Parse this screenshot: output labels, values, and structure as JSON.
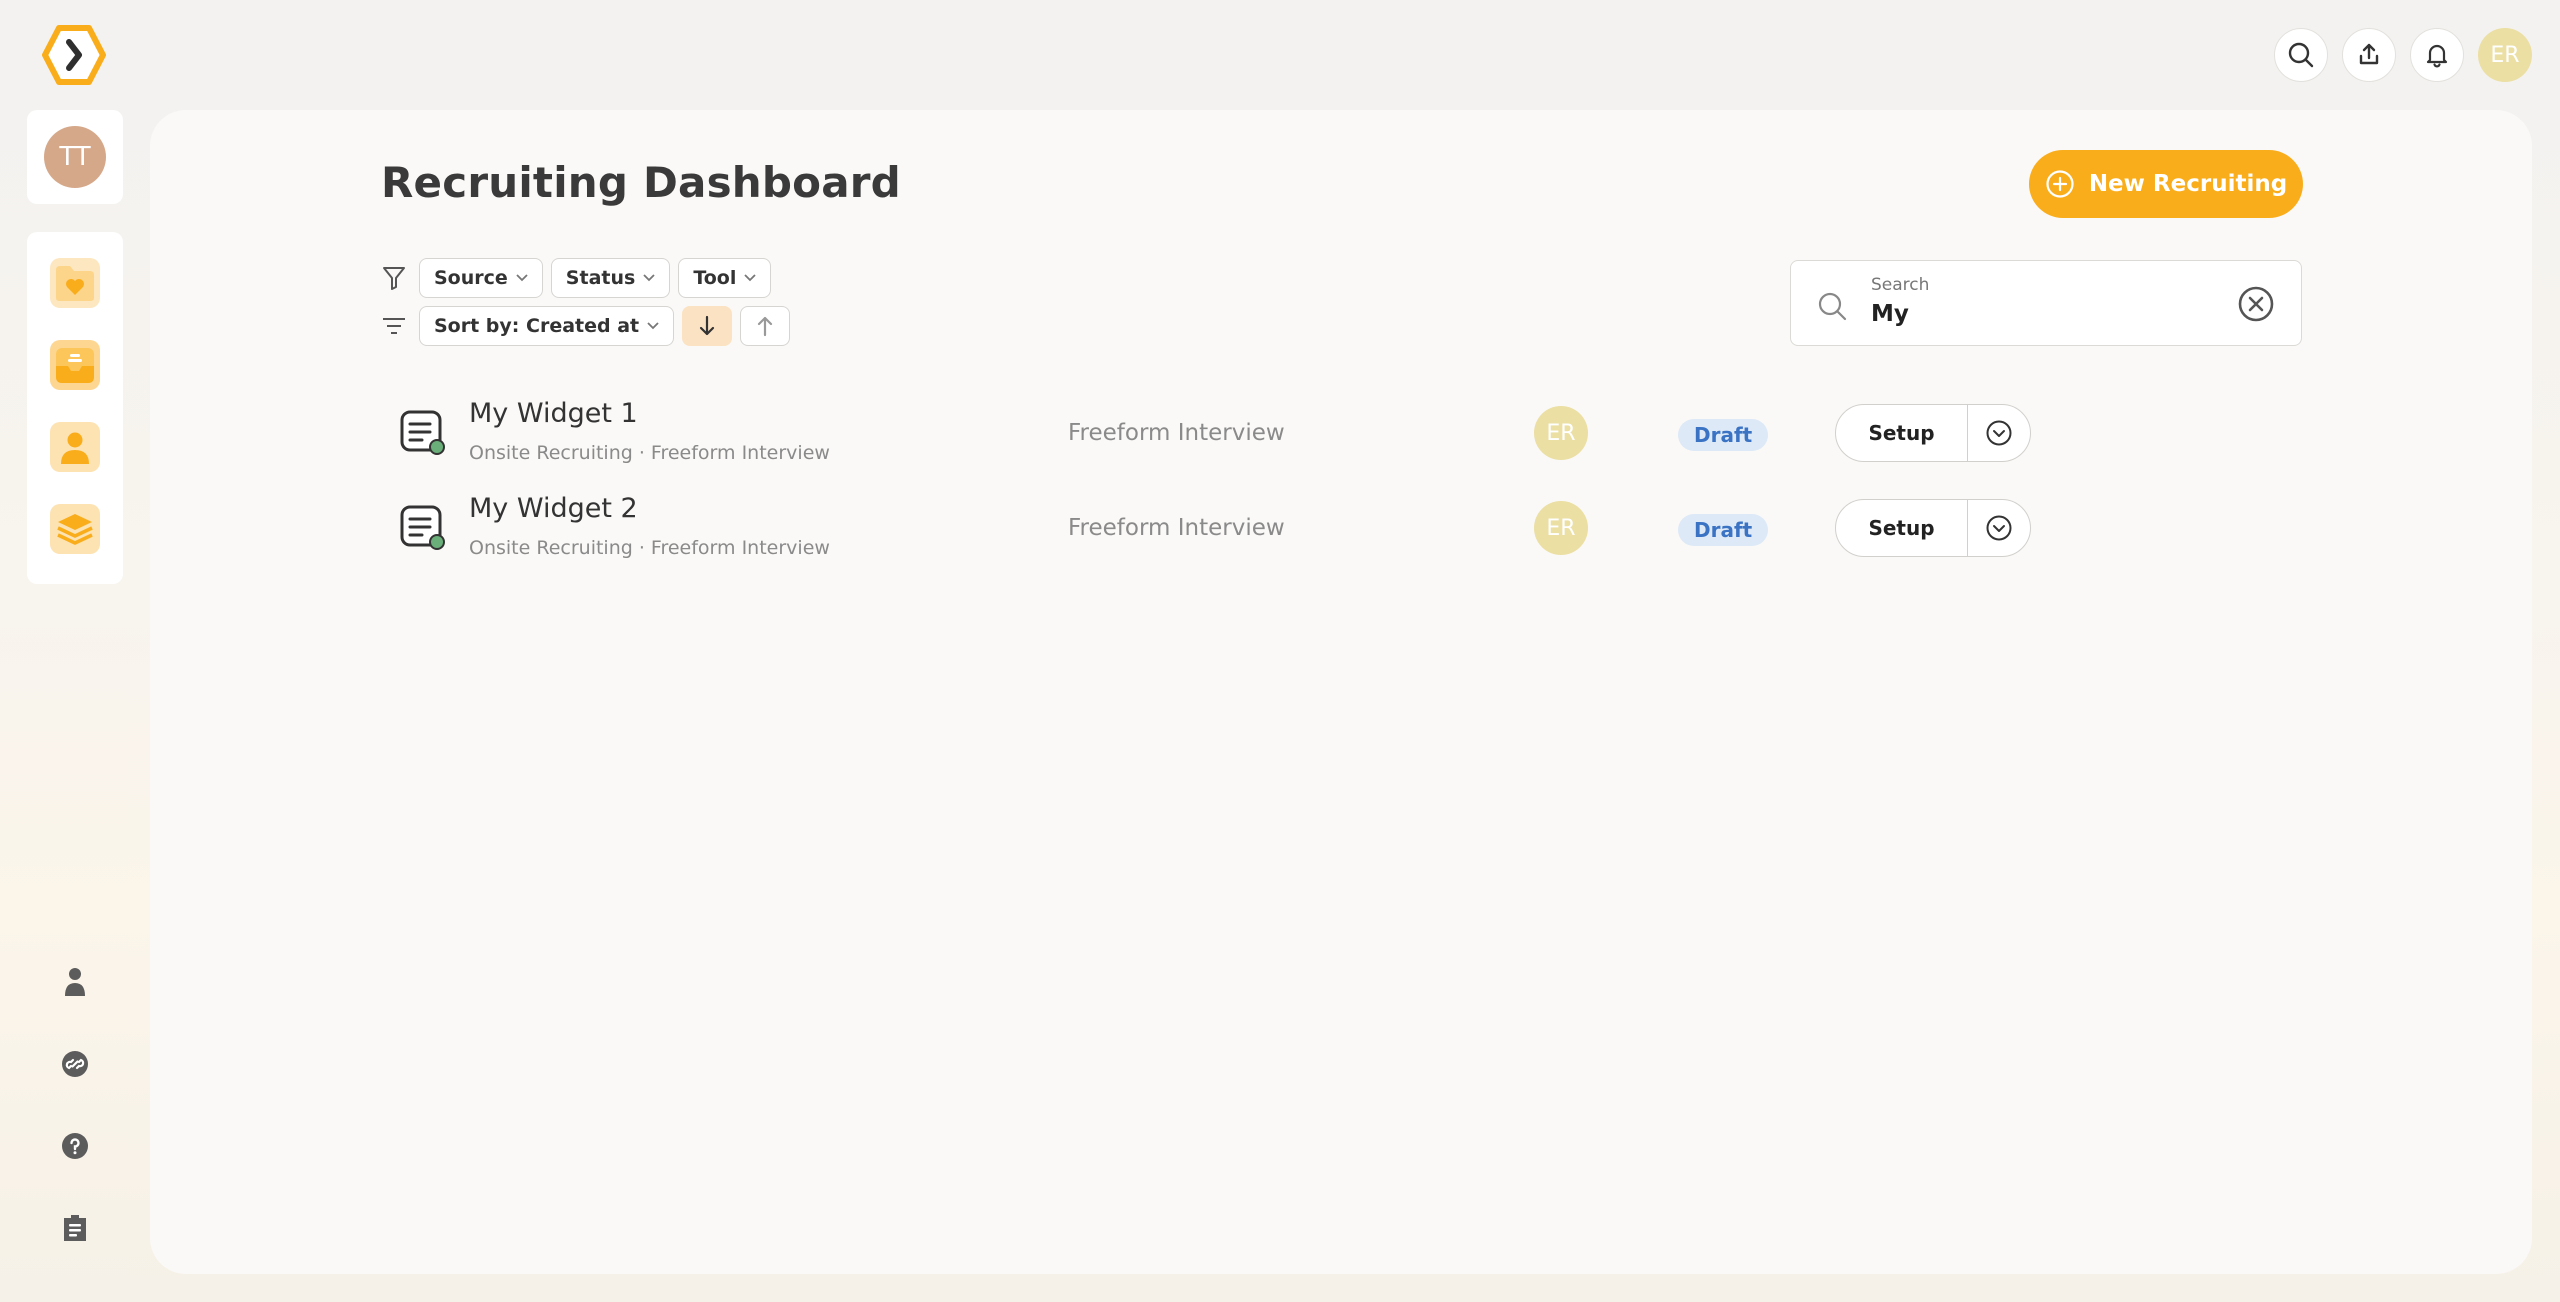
{
  "header": {
    "logo_icon": "hexagon-chevron-logo",
    "icons": [
      "search-icon",
      "upload-icon",
      "bell-icon"
    ],
    "user_avatar": "ER",
    "brand_color": "#f9ad1b"
  },
  "sidebar": {
    "user_avatar": "TT",
    "apps": [
      {
        "icon": "folder-heart-icon"
      },
      {
        "icon": "inbox-icon"
      },
      {
        "icon": "person-icon"
      },
      {
        "icon": "layers-icon"
      }
    ],
    "bottom": [
      {
        "icon": "profile-icon"
      },
      {
        "icon": "link-icon"
      },
      {
        "icon": "help-icon"
      },
      {
        "icon": "clipboard-icon"
      }
    ]
  },
  "main": {
    "title": "Recruiting Dashboard",
    "new_button_label": "New Recruiting",
    "filters": {
      "source": "Source",
      "status": "Status",
      "tool": "Tool",
      "sort": "Sort by: Created at"
    },
    "search": {
      "label": "Search",
      "value": "My"
    },
    "items": [
      {
        "name": "My Widget 1",
        "subtitle": "Onsite Recruiting · Freeform Interview",
        "type": "Freeform Interview",
        "owner": "ER",
        "status": "Draft",
        "action": "Setup"
      },
      {
        "name": "My Widget 2",
        "subtitle": "Onsite Recruiting · Freeform Interview",
        "type": "Freeform Interview",
        "owner": "ER",
        "status": "Draft",
        "action": "Setup"
      }
    ]
  }
}
